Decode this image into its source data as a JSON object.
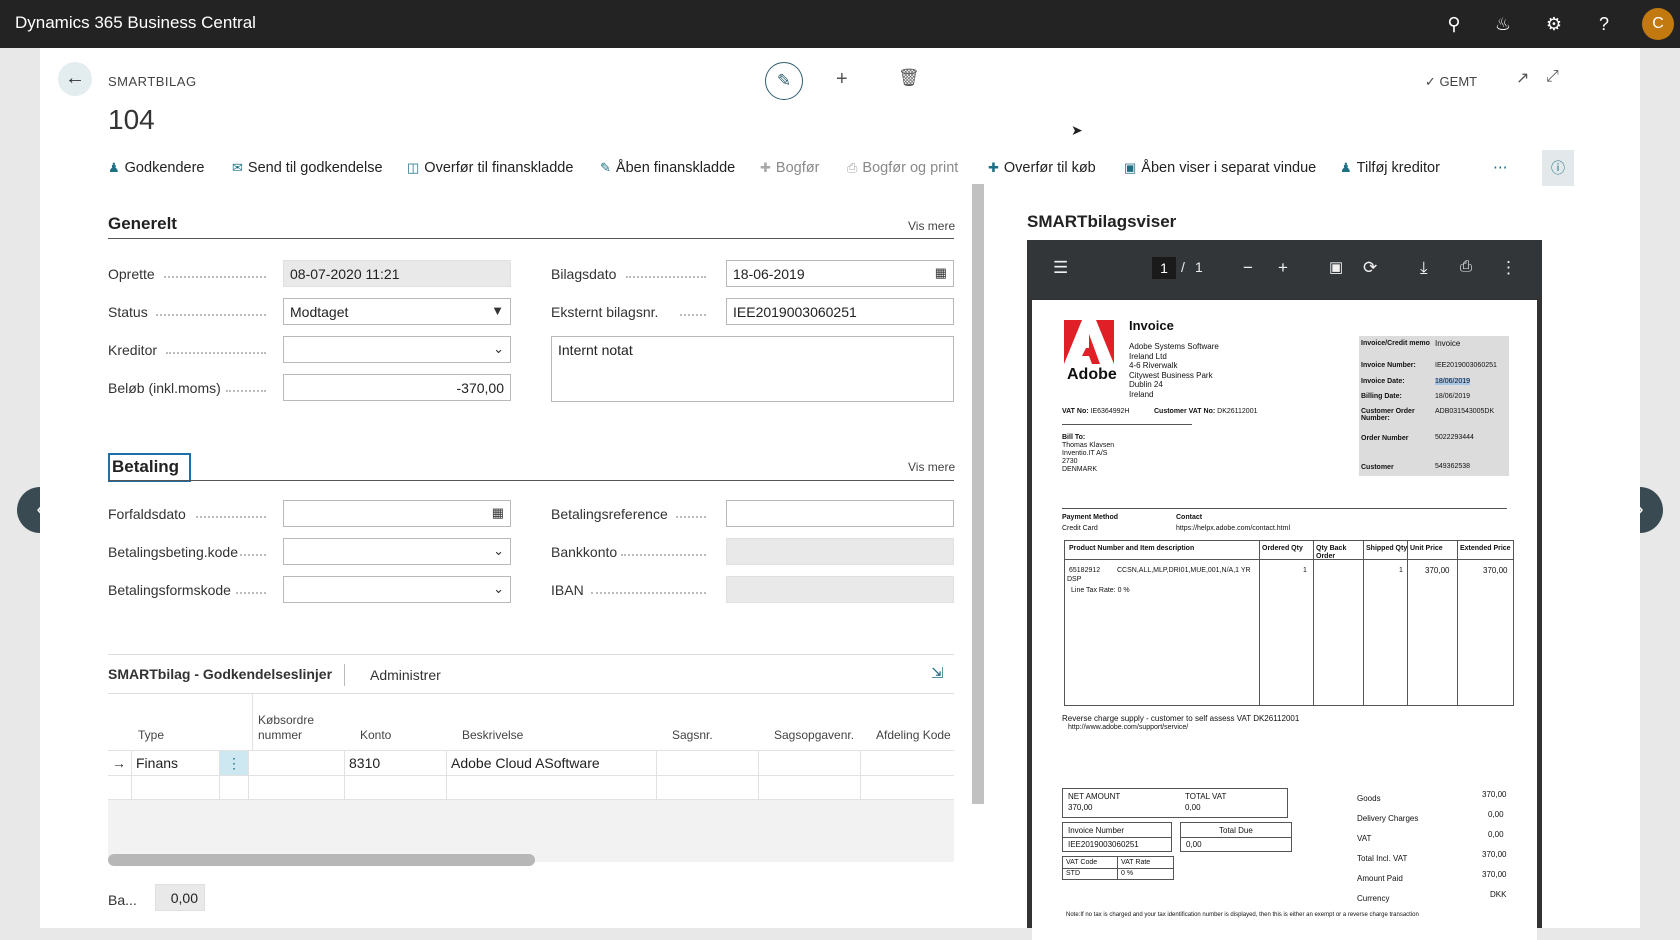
{
  "app": {
    "title": "Dynamics 365 Business Central",
    "avatar": "C"
  },
  "header": {
    "breadcrumb": "SMARTBILAG",
    "record": "104",
    "saved": "GEMT"
  },
  "actions": [
    {
      "label": "Godkendere",
      "icon": "people-icon",
      "enabled": true
    },
    {
      "label": "Send til godkendelse",
      "icon": "send-icon",
      "enabled": true
    },
    {
      "label": "Overfør til finanskladde",
      "icon": "transfer-icon",
      "enabled": true
    },
    {
      "label": "Åben finanskladde",
      "icon": "journal-icon",
      "enabled": true
    },
    {
      "label": "Bogfør",
      "icon": "post-icon",
      "enabled": false
    },
    {
      "label": "Bogfør og print",
      "icon": "print-icon",
      "enabled": false
    },
    {
      "label": "Overfør til køb",
      "icon": "transfer-purchase-icon",
      "enabled": true
    },
    {
      "label": "Åben viser i separat vindue",
      "icon": "image-icon",
      "enabled": true
    },
    {
      "label": "Tilføj kreditor",
      "icon": "person-icon",
      "enabled": true
    }
  ],
  "generelt": {
    "title": "Generelt",
    "more": "Vis mere",
    "oprette_label": "Oprette",
    "oprette": "08-07-2020 11:21",
    "status_label": "Status",
    "status": "Modtaget",
    "kreditor_label": "Kreditor",
    "kreditor": "",
    "belob_label": "Beløb (inkl.moms)",
    "belob": "-370,00",
    "bilagsdato_label": "Bilagsdato",
    "bilagsdato": "18-06-2019",
    "ekstern_label": "Eksternt bilagsnr.",
    "ekstern": "IEE2019003060251",
    "notat": "Internt notat"
  },
  "betaling": {
    "title": "Betaling",
    "more": "Vis mere",
    "forfald_label": "Forfaldsdato",
    "forfald": "",
    "betbeting_label": "Betalingsbeting.kode",
    "betbeting": "",
    "betform_label": "Betalingsformskode",
    "betform": "",
    "betref_label": "Betalingsreference",
    "betref": "",
    "bankkonto_label": "Bankkonto",
    "bankkonto": "",
    "iban_label": "IBAN",
    "iban": ""
  },
  "lines": {
    "title": "SMARTbilag - Godkendelseslinjer",
    "tab": "Administrer",
    "headers": [
      "Type",
      "Købsordre nummer",
      "Konto",
      "Beskrivelse",
      "Sagsnr.",
      "Sagsopgavenr.",
      "Afdeling Kode"
    ],
    "rows": [
      {
        "type": "Finans",
        "kob": "",
        "konto": "8310",
        "beskrivelse": "Adobe Cloud ASoftware",
        "sagsnr": "",
        "sagsopg": "",
        "afd": ""
      }
    ]
  },
  "balance": {
    "label": "Ba...",
    "value": "0,00"
  },
  "viewer": {
    "title": "SMARTbilagsviser",
    "page": "1",
    "pages": "1",
    "invoice": {
      "heading": "Invoice",
      "brand": "Adobe",
      "address": [
        "Adobe Systems Software",
        "Ireland Ltd",
        "4-6 Riverwalk",
        "Citywest Business Park",
        "Dublin 24",
        "Ireland"
      ],
      "vat_no_label": "VAT No:",
      "vat_no": "IE6364992H",
      "cust_vat_label": "Customer VAT No:",
      "cust_vat": "DK26112001",
      "bill_to_label": "Bill To:",
      "bill_to": [
        "Thomas Klavsen",
        "Inventio.IT A/S",
        "2730",
        "DENMARK"
      ],
      "meta": [
        {
          "k": "Invoice/Credit memo",
          "v": "Invoice"
        },
        {
          "k": "Invoice Number:",
          "v": "IEE2019003060251"
        },
        {
          "k": "Invoice Date:",
          "v": "18/06/2019"
        },
        {
          "k": "Billing Date:",
          "v": "18/06/2019"
        },
        {
          "k": "Customer Order Number:",
          "v": "ADB031543005DK"
        },
        {
          "k": "Order Number",
          "v": "5022293444"
        },
        {
          "k": "Customer",
          "v": "549362538"
        }
      ],
      "payment_method_label": "Payment Method",
      "payment_method": "Credit Card",
      "contact_label": "Contact",
      "contact": "https://helpx.adobe.com/contact.html",
      "table_headers": [
        "Product Number and Item description",
        "Ordered Qty",
        "Qty Back Order",
        "Shipped Qty",
        "Unit Price",
        "Extended Price"
      ],
      "item": {
        "number": "65182912",
        "desc": "CCSN,ALL,MLP,DRI01,MUE,001,N/A,1 YR",
        "desc2": "DSP",
        "tax": "Line Tax Rate: 0  %",
        "ordered": "1",
        "shipped": "1",
        "unit": "370,00",
        "ext": "370,00"
      },
      "reverse": "Reverse charge supply - customer to self assess VAT  DK26112001",
      "support": "http://www.adobe.com/support/service/",
      "net_label": "NET AMOUNT",
      "net": "370,00",
      "tvat_label": "TOTAL VAT",
      "tvat": "0,00",
      "invnum_label": "Invoice Number",
      "invnum": "IEE2019003060251",
      "due_label": "Total Due",
      "due": "0,00",
      "vatcode_label": "VAT Code",
      "vatcode": "STD",
      "vatrate_label": "VAT Rate",
      "vatrate": "0 %",
      "totals": [
        {
          "k": "Goods",
          "v": "370,00"
        },
        {
          "k": "Delivery Charges",
          "v": "0,00"
        },
        {
          "k": "VAT",
          "v": "0,00"
        },
        {
          "k": "Total Incl. VAT",
          "v": "370,00"
        },
        {
          "k": "Amount Paid",
          "v": "370,00"
        },
        {
          "k": "Currency",
          "v": "DKK"
        }
      ],
      "note": "Note:If no tax is charged and your tax identification number is displayed, then this is either an exempt or a reverse charge transaction"
    }
  }
}
